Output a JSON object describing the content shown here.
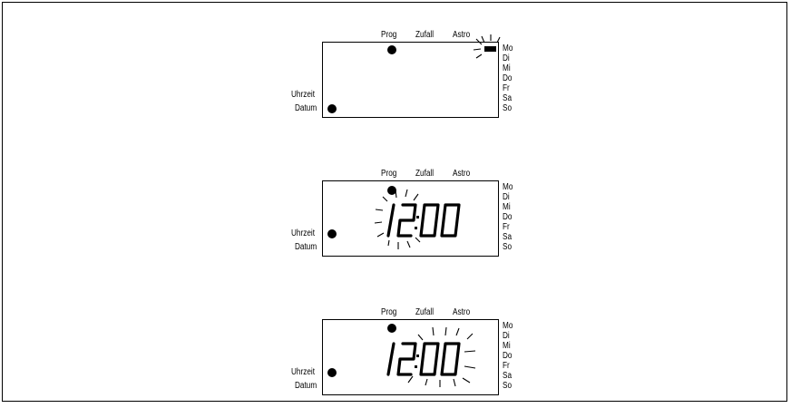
{
  "panels": [
    {
      "header": {
        "prog": "Prog",
        "zufall": "Zufall",
        "astro": "Astro"
      },
      "side": {
        "uhrzeit": "Uhrzeit",
        "datum": "Datum"
      },
      "days": [
        "Mo",
        "Di",
        "Mi",
        "Do",
        "Fr",
        "Sa",
        "So"
      ],
      "time": "",
      "blink": "weekday"
    },
    {
      "header": {
        "prog": "Prog",
        "zufall": "Zufall",
        "astro": "Astro"
      },
      "side": {
        "uhrzeit": "Uhrzeit",
        "datum": "Datum"
      },
      "days": [
        "Mo",
        "Di",
        "Mi",
        "Do",
        "Fr",
        "Sa",
        "So"
      ],
      "time": "12:00",
      "blink": "hours"
    },
    {
      "header": {
        "prog": "Prog",
        "zufall": "Zufall",
        "astro": "Astro"
      },
      "side": {
        "uhrzeit": "Uhrzeit",
        "datum": "Datum"
      },
      "days": [
        "Mo",
        "Di",
        "Mi",
        "Do",
        "Fr",
        "Sa",
        "So"
      ],
      "time": "12:00",
      "blink": "minutes"
    }
  ]
}
